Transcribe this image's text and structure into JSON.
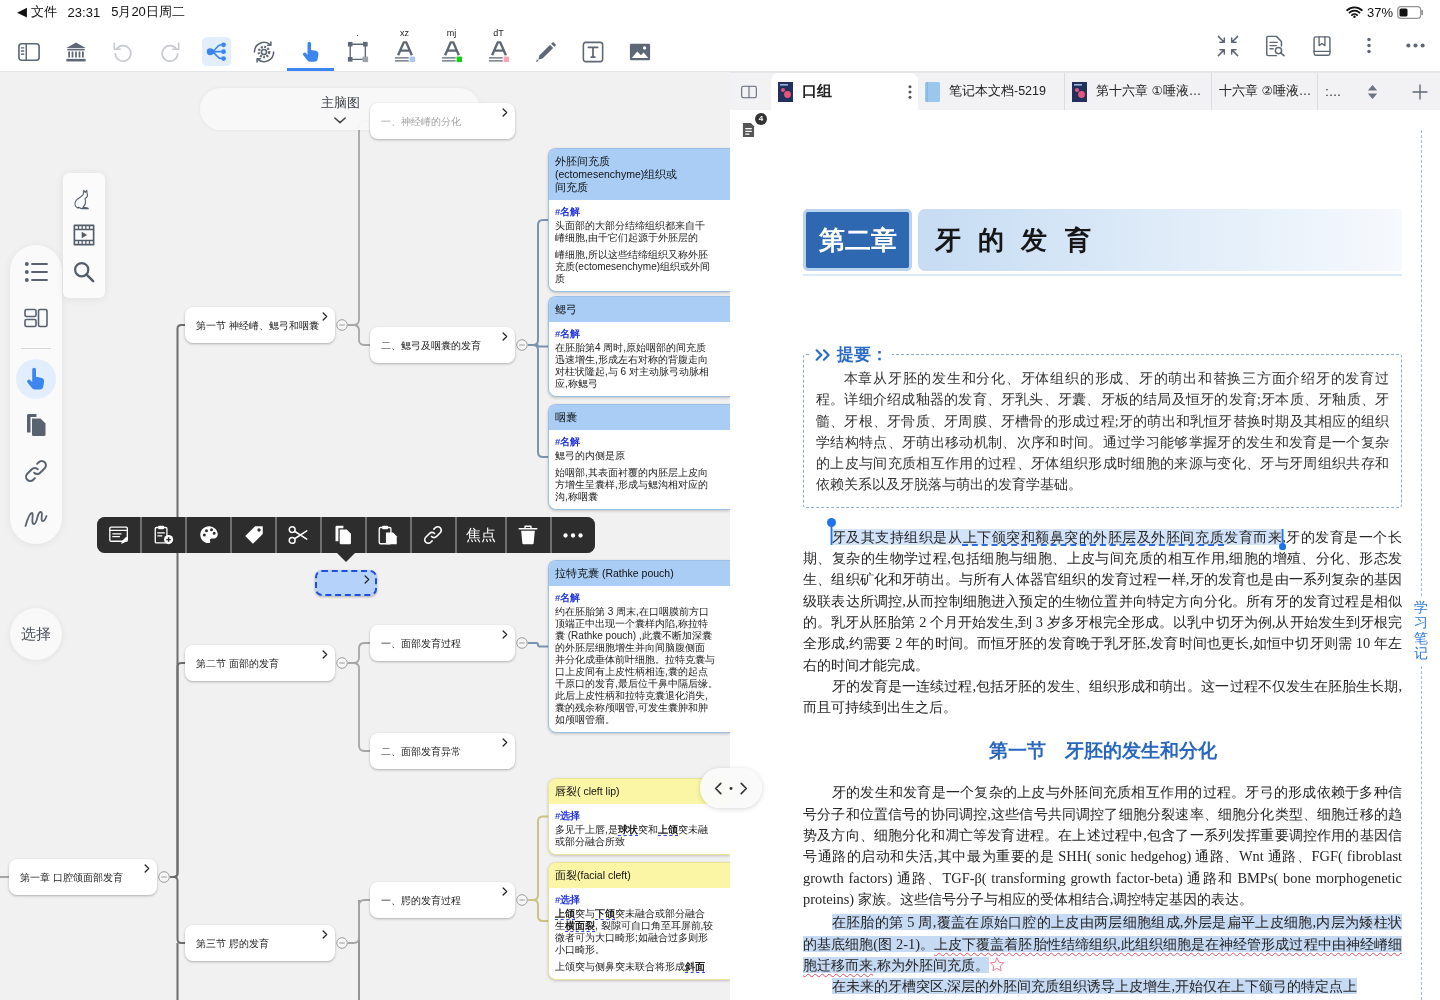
{
  "status_bar": {
    "back": "◀ 文件",
    "time": "23:31",
    "date": "5月20日周二",
    "battery": "37%"
  },
  "toolbar": {
    "tools": [
      {
        "kind": "sidebar",
        "selected": false,
        "active": false,
        "disabled": false
      },
      {
        "kind": "library",
        "selected": false,
        "active": false,
        "disabled": false
      },
      {
        "kind": "undo",
        "selected": false,
        "active": false,
        "disabled": true
      },
      {
        "kind": "redo",
        "selected": false,
        "active": false,
        "disabled": true
      },
      {
        "kind": "mindmap",
        "selected": false,
        "active": true,
        "disabled": false
      },
      {
        "kind": "sync-settings",
        "selected": false,
        "active": false,
        "disabled": false
      },
      {
        "kind": "pointer",
        "selected": true,
        "active": false,
        "disabled": false
      },
      {
        "kind": "select-area",
        "label": ".",
        "selected": false,
        "active": false,
        "disabled": false
      },
      {
        "kind": "text-color",
        "label": "xz",
        "color": "#a9c9f3",
        "selected": false,
        "active": false,
        "disabled": false
      },
      {
        "kind": "text-color",
        "label": "mj",
        "color": "#16cc16",
        "selected": false,
        "active": false,
        "disabled": false
      },
      {
        "kind": "text-color",
        "label": "dT",
        "color": "#f7a6b9",
        "selected": false,
        "active": false,
        "disabled": false
      },
      {
        "kind": "pencil",
        "selected": false,
        "active": false,
        "disabled": false
      },
      {
        "kind": "text-box",
        "selected": false,
        "active": false,
        "disabled": false
      },
      {
        "kind": "image",
        "selected": false,
        "active": false,
        "disabled": false
      }
    ],
    "right_tools": [
      {
        "kind": "collapse"
      },
      {
        "kind": "doc-search"
      },
      {
        "kind": "bookmarks"
      },
      {
        "kind": "more-vertical"
      },
      {
        "kind": "more-horizontal"
      }
    ]
  },
  "mind_map": {
    "title": "主脑图",
    "rail": {
      "groups": [
        [
          {
            "kind": "outline",
            "selected": false
          },
          {
            "kind": "layout",
            "selected": false
          }
        ],
        [
          {
            "kind": "pointer",
            "selected": true
          },
          {
            "kind": "pages",
            "selected": false
          },
          {
            "kind": "link",
            "selected": false
          },
          {
            "kind": "scribble",
            "selected": false
          }
        ]
      ]
    },
    "panel": [
      {
        "kind": "cat"
      },
      {
        "kind": "film"
      },
      {
        "kind": "search"
      }
    ],
    "select_button": "选择",
    "root": {
      "text": "第一章 口腔颌面部发育",
      "selected": false,
      "dimmed": false,
      "incoming_line": true,
      "children_below": true,
      "children": [
        {
          "text": "第一节 神经嵴、鳃弓和咽囊",
          "selected": false,
          "dimmed": false,
          "children_below": false,
          "children": [
            {
              "text": "一、神经嵴的分化",
              "selected": false,
              "dimmed": true
            },
            {
              "text": "二、鳃弓及咽囊的发育",
              "selected": false,
              "dimmed": false,
              "cards": [
                {
                  "title_lines": [
                    "外胚间充质",
                    "(ectomesenchyme)组织或",
                    "间充质"
                  ],
                  "color": "#a9cdf5",
                  "tag": "#名解",
                  "paragraphs": [
                    [
                      "头面部的大部分结缔组织都来自千",
                      "嵴细胞,由千它们起源于外胚层的"
                    ],
                    [
                      "嵴细胞,所以这些结缔组织又称外胚",
                      "充质(ectomesenchyme)组织或外间",
                      "质"
                    ]
                  ]
                },
                {
                  "title_lines": [
                    "鳃弓"
                  ],
                  "color": "#a9cdf5",
                  "tag": "#名解",
                  "paragraphs": [
                    [
                      "在胚胎第4 周时,原始咽部的间充质",
                      "迅速增生,形成左右对称的背腹走向",
                      "对柱状隆起,与 6 对主动脉弓动脉相",
                      "应,称鳃弓"
                    ]
                  ]
                },
                {
                  "title_lines": [
                    "咽囊"
                  ],
                  "color": "#a9cdf5",
                  "tag": "#名解",
                  "paragraphs": [
                    [
                      "鳃弓的内侧是原"
                    ],
                    [
                      "始咽部,其表面衬覆的内胚层上皮向",
                      "方增生呈囊样,形成与鳃沟相对应的",
                      "沟,称咽囊"
                    ]
                  ]
                }
              ]
            }
          ]
        },
        {
          "text": "第二节 面部的发育",
          "selected": false,
          "dimmed": false,
          "children_below": false,
          "children": [
            {
              "text": "一、面部发育过程",
              "selected": false,
              "dimmed": false,
              "cards": [
                {
                  "title_lines": [
                    "拉特克囊 (Rathke pouch)"
                  ],
                  "color": "#a9cdf5",
                  "tag": "#名解",
                  "paragraphs": [
                    [
                      "约在胚胎第 3 周末,在口咽膜前方口",
                      "顶端正中出现一个囊样内陷,称拉特",
                      "囊 (Rathke pouch) ,此囊不断加深囊",
                      "的外胚层细胞增生并向间脑腹侧面",
                      "并分化成垂体前叶细胞。拉特克囊与",
                      "口上皮间有上皮性柄相连,囊的起点",
                      "千原口的发育,最后位千鼻中隔后缘。",
                      "此后上皮性柄和拉特克囊退化消失,",
                      "囊的残余称颅咽管,可发生囊肿和肿",
                      "如颅咽管瘤。"
                    ]
                  ]
                }
              ]
            },
            {
              "text": "二、面部发育异常",
              "selected": false,
              "dimmed": false
            }
          ]
        },
        {
          "text": "第三节 腭的发育",
          "selected": false,
          "dimmed": false,
          "children_below": true,
          "children": [
            {
              "text": "一、腭的发育过程",
              "selected": false,
              "dimmed": false,
              "cards": [
                {
                  "title_lines": [
                    "唇裂( cleft lip)"
                  ],
                  "color": "#fbf5a6",
                  "tag": "#选择",
                  "paragraphs": [
                    [
                      "多见千上唇,是**球状**突和**上颌**突未融",
                      "或部分融合所致"
                    ]
                  ]
                },
                {
                  "title_lines": [
                    "面裂(facial cleft)"
                  ],
                  "color": "#fbf5a6",
                  "tag": "#选择",
                  "paragraphs": [
                    [
                      "**上颌**突与**下颌**突未融合或部分融合",
                      "生**横面裂**, 裂隙可自口角至耳屏前,较",
                      "微者可为大口畸形;如融合过多则形",
                      "小口畸形。"
                    ],
                    [
                      "上颌突与侧鼻突未联合将形成**斜面**"
                    ]
                  ]
                }
              ]
            }
          ]
        }
      ]
    },
    "floating_topics": [
      {
        "selected": true
      }
    ],
    "context_menu": [
      {
        "kind": "note-edit"
      },
      {
        "kind": "add-clipboard"
      },
      {
        "kind": "palette"
      },
      {
        "kind": "tag"
      },
      {
        "kind": "cut"
      },
      {
        "kind": "copy"
      },
      {
        "kind": "paste"
      },
      {
        "kind": "link"
      },
      {
        "kind": "text",
        "label": "焦点"
      },
      {
        "kind": "delete"
      },
      {
        "kind": "more"
      }
    ]
  },
  "document": {
    "tabs": [
      {
        "kind": "book",
        "title": "口组",
        "selected": true
      },
      {
        "kind": "notebook",
        "title": "笔记本文档-5219",
        "selected": false
      },
      {
        "kind": "book",
        "title": "第十六章 ①唾液…",
        "selected": false
      },
      {
        "kind": "plain",
        "title": "十六章 ②唾液…",
        "selected": false
      },
      {
        "kind": "plain",
        "title": ":…",
        "selected": false
      }
    ],
    "note_count": "4",
    "chapter": {
      "number": "第二章",
      "title": "牙 的 发 育"
    },
    "summary": {
      "label": "提要：",
      "text": "本章从牙胚的发生和分化、牙体组织的形成、牙的萌出和替换三方面介绍牙的发育过程。详细介绍成釉器的发育、牙乳头、牙囊、牙板的结局及恒牙的发育;牙本质、牙釉质、牙髓、牙根、牙骨质、牙周膜、牙槽骨的形成过程;牙的萌出和乳恒牙替换时期及其相应的组织学结构特点、牙萌出移动机制、次序和时间。通过学习能够掌握牙的发生和发育是一个复杂的上皮与间充质相互作用的过程、牙体组织形成时细胞的来源与变化、牙与牙周组织共存和依赖关系以及牙脱落与萌出的发育学基础。"
    },
    "blocks": [
      {
        "kind": "paragraph",
        "highlighted": false,
        "starred": false,
        "segments": [
          {
            "kind": "plain",
            "text": "牙及其支持组织是从",
            "selected": true
          },
          {
            "kind": "dashed_underline",
            "text": "上下颌突和额鼻突的外胚层及外胚间充质",
            "selected": true
          },
          {
            "kind": "plain",
            "text": "发育而来",
            "selected": true
          },
          {
            "kind": "plain",
            "text": ",牙的发育是一个长期、复杂的生物学过程,包括细胞与细胞、上皮与间充质的相互作用,细胞的增殖、分化、形态发生、组织矿化和牙萌出。与所有人体器官组织的发育过程一样,牙的发育也是由一系列复杂的基因级联表达所调控,从而控制细胞进入预定的生物位置并向特定方向分化。所有牙的发育过程是相似的。乳牙从胚胎第 2 个月开始发生,到 3 岁多牙根完全形成。以乳中切牙为例,从开始发生到牙根完全形成,约需要 2 年的时间。而恒牙胚的发育晚于乳牙胚,发育时间也更长,如恒中切牙则需 10 年左右的时间才能完成。",
            "selected": false
          }
        ]
      },
      {
        "kind": "paragraph",
        "highlighted": false,
        "starred": false,
        "segments": [
          {
            "kind": "plain",
            "text": "牙的发育是一连续过程,包括牙胚的发生、组织形成和萌出。这一过程不仅发生在胚胎生长期,而且可持续到出生之后。",
            "selected": false
          }
        ]
      },
      {
        "kind": "heading",
        "text": "第一节　牙胚的发生和分化"
      },
      {
        "kind": "paragraph",
        "highlighted": false,
        "starred": false,
        "segments": [
          {
            "kind": "plain",
            "text": "牙的发生和发育是一个复杂的上皮与外胚间充质相互作用的过程。牙弓的形成依赖于多种信号分子和位置信号的协同调控,这些信号共同调控了细胞分裂速率、细胞分化类型、细胞迁移的趋势及方向、细胞分化和凋亡等发育进程。在上述过程中,包含了一系列发挥重要调控作用的基因信号通路的启动和失活,其中最为重要的是 SHH( sonic hedgehog) 通路、Wnt 通路、FGF( fibroblast growth factors) 通路、TGF-β( transforming growth factor-beta) 通路和 BMPs( bone morphogenetic proteins) 家族。这些信号分子与相应的受体相结合,调控特定基因的表达。",
            "selected": false
          }
        ]
      },
      {
        "kind": "paragraph",
        "highlighted": true,
        "starred": true,
        "segments": [
          {
            "kind": "plain",
            "text": "在胚胎的第 5 周,覆盖在原始口腔的上皮由两层细胞组成,外层是扁平上皮细胞,内层为矮柱状的基底细胞(图 2-1)。",
            "selected": false
          },
          {
            "kind": "pen_underline",
            "text": "上皮下覆盖着胚胎性结缔组织,此组织细胞是在神经管形成过程中由神经嵴细胞迁移而来",
            "selected": false
          },
          {
            "kind": "plain",
            "text": ",称为外胚间充质。",
            "selected": false
          }
        ]
      },
      {
        "kind": "paragraph",
        "highlighted": true,
        "starred": false,
        "segments": [
          {
            "kind": "plain",
            "text": "在未来的牙槽突区,深层的外胚间充质组织诱导上皮增生,开始仅在上下颌弓的特定点上",
            "selected": false
          }
        ]
      }
    ],
    "side_tab": "学习笔记"
  }
}
